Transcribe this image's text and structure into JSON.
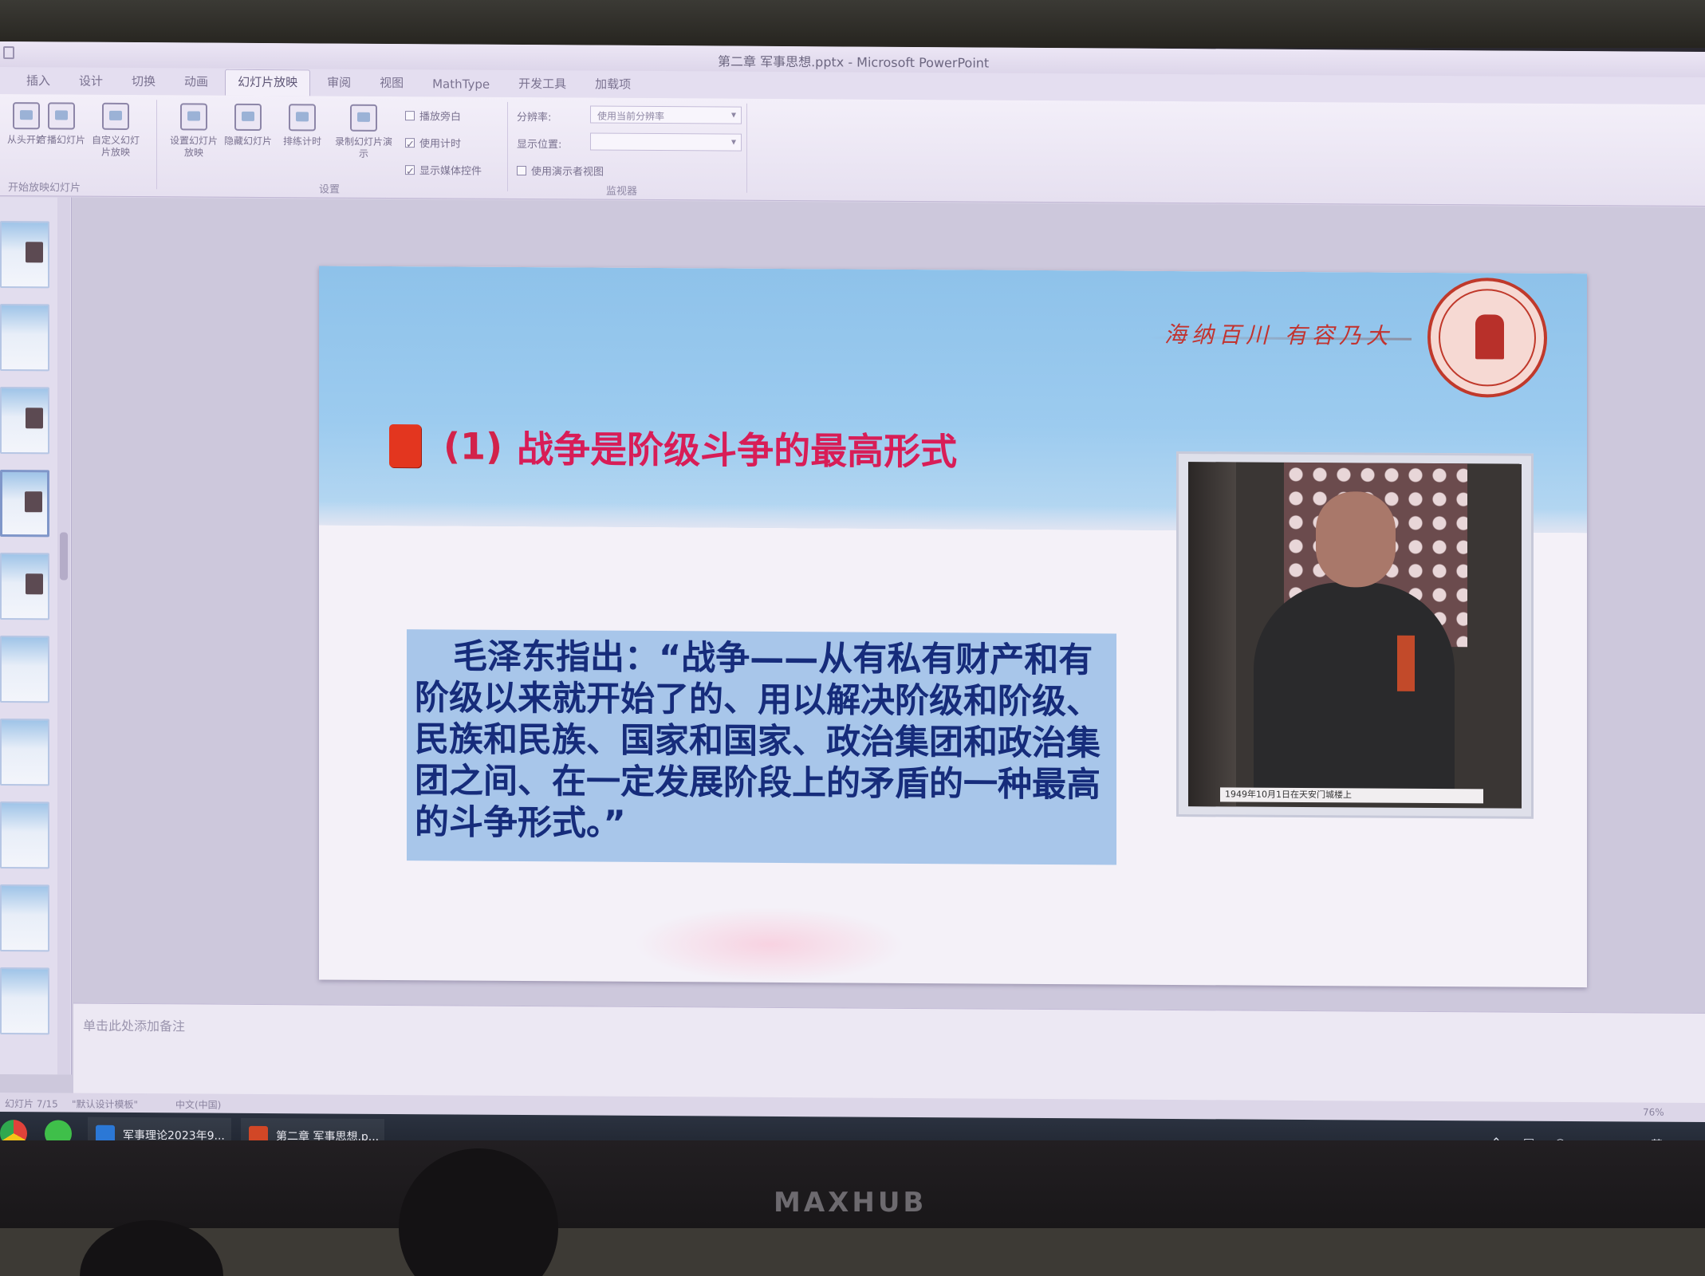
{
  "window": {
    "title": "第二章 军事思想.pptx - Microsoft PowerPoint"
  },
  "ribbon": {
    "tabs": [
      "插入",
      "设计",
      "切换",
      "动画",
      "幻灯片放映",
      "审阅",
      "视图",
      "MathType",
      "开发工具",
      "加载项"
    ],
    "active_tab": "幻灯片放映",
    "buttons": [
      {
        "label": "从头开始",
        "icon": "play-icon"
      },
      {
        "label": "广播幻灯片",
        "icon": "broadcast-icon"
      },
      {
        "label": "自定义幻灯片放映",
        "icon": "custom-show-icon"
      },
      {
        "label": "设置幻灯片放映",
        "icon": "setup-icon"
      },
      {
        "label": "隐藏幻灯片",
        "icon": "hide-slide-icon"
      },
      {
        "label": "排练计时",
        "icon": "rehearse-icon"
      },
      {
        "label": "录制幻灯片演示",
        "icon": "record-icon"
      }
    ],
    "checkboxes": [
      {
        "label": "播放旁白",
        "checked": false
      },
      {
        "label": "使用计时",
        "checked": true
      },
      {
        "label": "显示媒体控件",
        "checked": true
      },
      {
        "label": "使用演示者视图",
        "checked": false
      }
    ],
    "resolution_label": "分辨率:",
    "resolution_value": "使用当前分辨率",
    "show_on_label": "显示位置:",
    "groups": [
      "开始放映幻灯片",
      "设置",
      "监视器"
    ]
  },
  "slide": {
    "motto": "海纳百川 有容乃大",
    "title_number": "(1)",
    "title_text": "战争是阶级斗争的最高形式",
    "quote": "毛泽东指出：“战争——从有私有财产和有阶级以来就开始了的、用以解决阶级和阶级、民族和民族、国家和国家、政治集团和政治集团之间、在一定发展阶段上的矛盾的一种最高的斗争形式。”",
    "photo_caption": "1949年10月1日在天安门城楼上"
  },
  "notes": {
    "placeholder": "单击此处添加备注"
  },
  "statusbar": {
    "slide_info": "幻灯片 7/15",
    "theme": "\"默认设计模板\"",
    "language": "中文(中国)",
    "zoom": "76%"
  },
  "taskbar": {
    "apps": [
      {
        "label": "军事理论2023年9...",
        "icon": "word-doc-icon",
        "color": "#2b78d6"
      },
      {
        "label": "第二章 军事思想.p...",
        "icon": "powerpoint-icon",
        "color": "#d24726"
      }
    ]
  },
  "bezel": {
    "brand": "MAXHUB"
  }
}
